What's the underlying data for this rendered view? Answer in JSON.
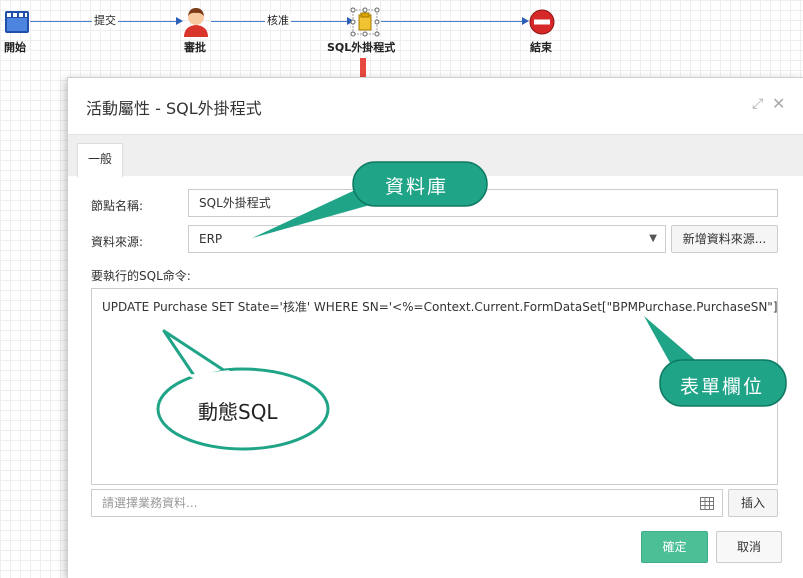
{
  "workflow": {
    "nodes": [
      {
        "id": "start",
        "label": "開始"
      },
      {
        "id": "approve",
        "label": "審批"
      },
      {
        "id": "sql",
        "label": "SQL外掛程式"
      },
      {
        "id": "end",
        "label": "結束"
      }
    ],
    "edges": [
      {
        "label": "提交"
      },
      {
        "label": "核准"
      }
    ]
  },
  "dialog": {
    "title": "活動屬性 - SQL外掛程式",
    "tabs": [
      {
        "label": "一般"
      }
    ],
    "node_name": {
      "label": "節點名稱:",
      "value": "SQL外掛程式"
    },
    "data_source": {
      "label": "資料來源:",
      "value": "ERP",
      "add_button": "新增資料來源..."
    },
    "sql": {
      "label": "要執行的SQL命令:",
      "value": "UPDATE Purchase SET State='核准' WHERE SN='<%=Context.Current.FormDataSet[\"BPMPurchase.PurchaseSN\"]%>'"
    },
    "business_data": {
      "placeholder": "請選擇業務資料...",
      "insert_button": "插入"
    },
    "ok_button": "確定",
    "cancel_button": "取消"
  },
  "callouts": {
    "database": "資料庫",
    "form_field": "表單欄位",
    "dynamic_sql": "動態SQL"
  },
  "colors": {
    "callout_green": "#1fa487",
    "primary_button": "#4cbf97",
    "flow_line": "#4a7fd0",
    "indicator_arrow": "#e84a3f"
  }
}
